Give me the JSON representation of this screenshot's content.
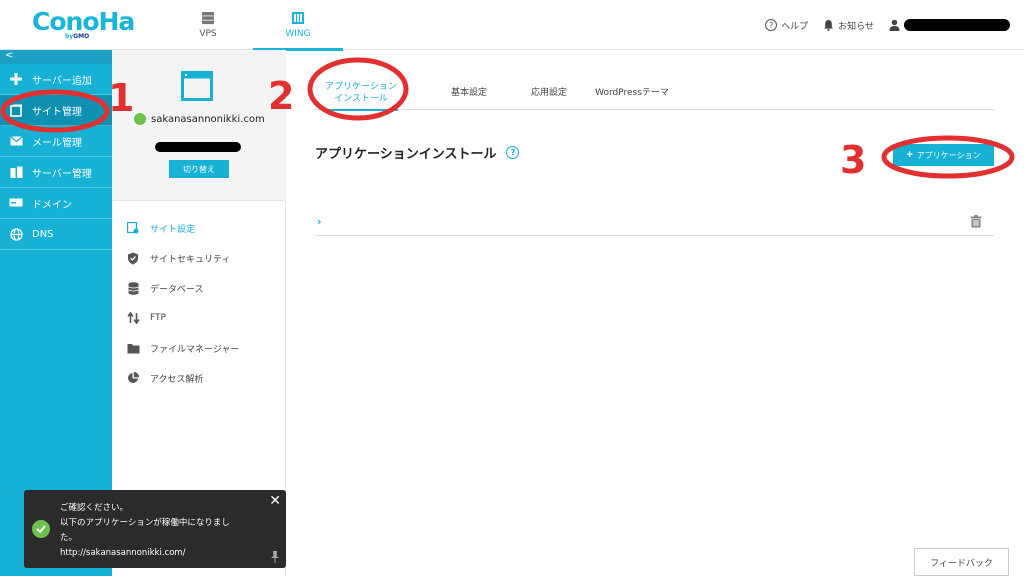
{
  "brand": {
    "logo_main": "ConoHa",
    "logo_sub_by": "by",
    "logo_sub_gmo": "GMO"
  },
  "topnav": {
    "vps": "VPS",
    "wing": "WING"
  },
  "header": {
    "help": "ヘルプ",
    "notices": "お知らせ"
  },
  "sidebar": {
    "collapse": "<",
    "items": [
      {
        "label": "サーバー追加",
        "icon": "plus-icon"
      },
      {
        "label": "サイト管理",
        "icon": "site-icon"
      },
      {
        "label": "メール管理",
        "icon": "mail-icon"
      },
      {
        "label": "サーバー管理",
        "icon": "server-icon"
      },
      {
        "label": "ドメイン",
        "icon": "domain-icon"
      },
      {
        "label": "DNS",
        "icon": "globe-icon"
      }
    ]
  },
  "site": {
    "name": "sakanasannonikki.com",
    "switch_label": "切り替え"
  },
  "mid_menu": [
    {
      "label": "サイト設定",
      "icon": "site-settings-icon"
    },
    {
      "label": "サイトセキュリティ",
      "icon": "shield-icon"
    },
    {
      "label": "データベース",
      "icon": "database-icon"
    },
    {
      "label": "FTP",
      "icon": "transfer-icon"
    },
    {
      "label": "ファイルマネージャー",
      "icon": "folder-icon"
    },
    {
      "label": "アクセス解析",
      "icon": "pie-chart-icon"
    }
  ],
  "tabs": {
    "app_install_line1": "アプリケーション",
    "app_install_line2": "インストール",
    "basic": "基本設定",
    "advanced": "応用設定",
    "wordpress": "WordPressテーマ"
  },
  "main": {
    "title": "アプリケーションインストール",
    "help_mark": "?",
    "add_app_label": "アプリケーション",
    "add_plus": "+"
  },
  "annotations": {
    "n1": "1",
    "n2": "2",
    "n3": "3",
    "color": "#e23030"
  },
  "toast": {
    "line1": "ご確認ください。",
    "line2": "以下のアプリケーションが稼働中になりまし",
    "line3": "た。",
    "line4": "http://sakanasannonikki.com/",
    "close": "✕"
  },
  "feedback": "フィードバック",
  "colors": {
    "accent": "#17b1d5",
    "sidebar": "#17b1d5",
    "success": "#6cc24a"
  }
}
